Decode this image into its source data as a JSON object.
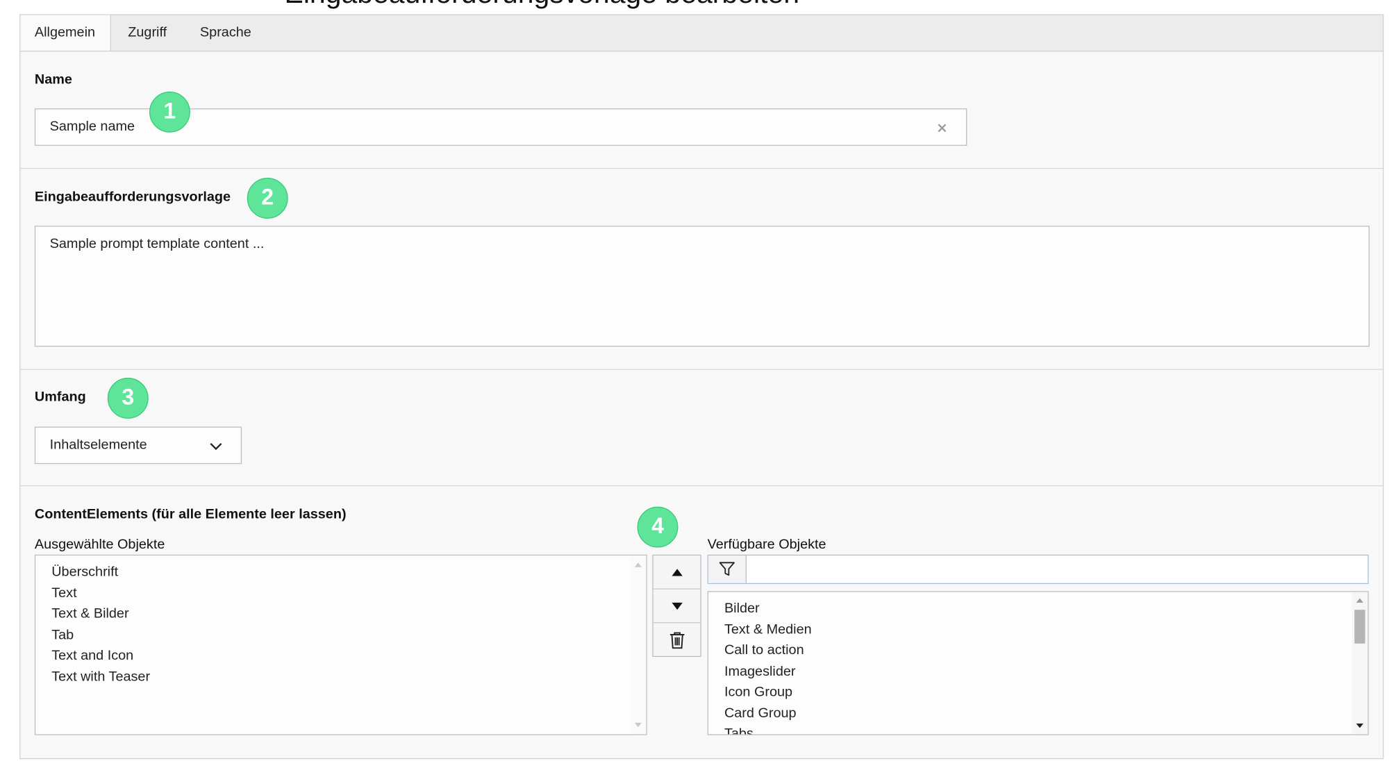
{
  "page_header": {
    "title": "Eingabeaufforderungsvorlage bearbeiten"
  },
  "tabs": [
    {
      "label": "Allgemein",
      "active": true
    },
    {
      "label": "Zugriff",
      "active": false
    },
    {
      "label": "Sprache",
      "active": false
    }
  ],
  "name_section": {
    "label": "Name",
    "value": "Sample name",
    "badge": "1",
    "clear_icon": "close-icon"
  },
  "template_section": {
    "label": "Eingabeaufforderungsvorlage",
    "value": "Sample prompt template content ...",
    "badge": "2"
  },
  "scope_section": {
    "label": "Umfang",
    "selected": "Inhaltselemente",
    "badge": "3",
    "dropdown_icon": "chevron-down-icon"
  },
  "content_elements": {
    "label": "ContentElements (für alle Elemente leer lassen)",
    "badge": "4",
    "selected_label": "Ausgewählte Objekte",
    "available_label": "Verfügbare Objekte",
    "filter_value": "",
    "selected_items": [
      "Überschrift",
      "Text",
      "Text & Bilder",
      "Tab",
      "Text and Icon",
      "Text with Teaser"
    ],
    "available_items": [
      "Bilder",
      "Text & Medien",
      "Call to action",
      "Imageslider",
      "Icon Group",
      "Card Group",
      "Tabs"
    ],
    "buttons": [
      "move-up-icon",
      "move-down-icon",
      "trash-icon"
    ]
  },
  "colors": {
    "badge": "#5ee59a",
    "badge_border": "#39c878",
    "focus": "#7ea8d6",
    "panel_bg": "#f8f8f8"
  }
}
